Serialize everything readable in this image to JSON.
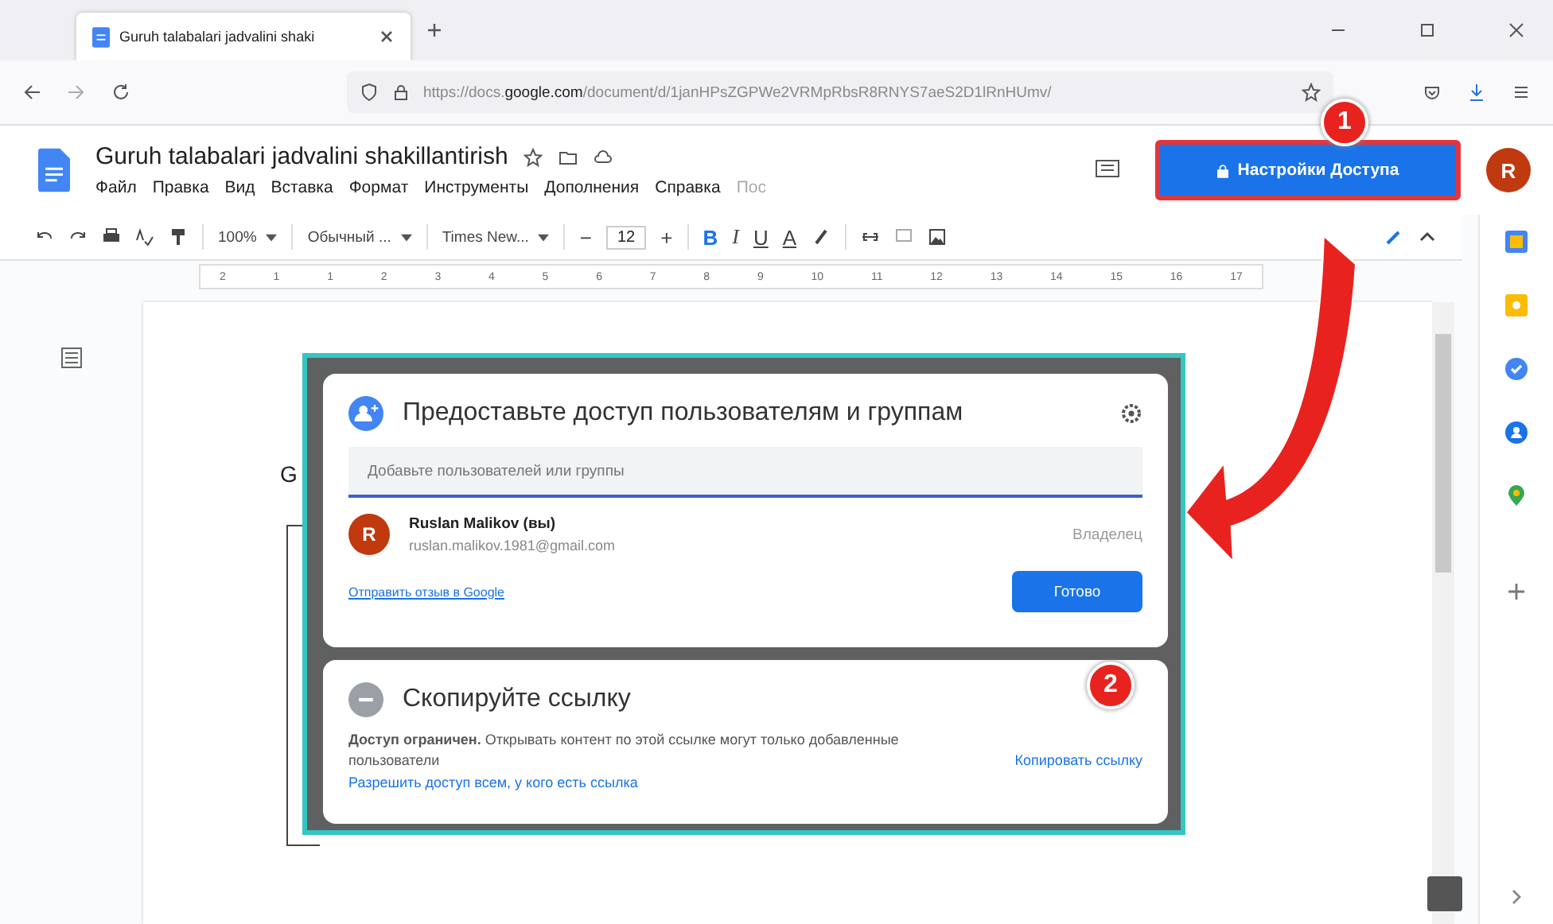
{
  "browser": {
    "tab_title": "Guruh talabalari jadvalini shaki",
    "url_start": "https://docs.",
    "url_domain": "google.com",
    "url_rest": "/document/d/1janHPsZGPWe2VRMpRbsR8RNYS7aeS2D1lRnHUmv/"
  },
  "doc": {
    "title": "Guruh talabalari jadvalini shakillantirish",
    "menu": [
      "Файл",
      "Правка",
      "Вид",
      "Вставка",
      "Формат",
      "Инструменты",
      "Дополнения",
      "Справка"
    ],
    "last_edit": "Пос",
    "share_button": "Настройки Доступа",
    "avatar": "R"
  },
  "toolbar": {
    "zoom": "100%",
    "style": "Обычный ...",
    "font": "Times New...",
    "minus": "−",
    "size": "12",
    "plus": "+",
    "bold": "B",
    "italic": "I",
    "underline": "U",
    "text_color": "A"
  },
  "ruler": [
    "2",
    "1",
    "1",
    "2",
    "3",
    "4",
    "5",
    "6",
    "7",
    "8",
    "9",
    "10",
    "11",
    "12",
    "13",
    "14",
    "15",
    "16",
    "17"
  ],
  "page": {
    "fragment": "G"
  },
  "share_dialog": {
    "title": "Предоставьте доступ пользователям и группам",
    "input_placeholder": "Добавьте пользователей или группы",
    "user": {
      "avatar": "R",
      "name": "Ruslan Malikov (вы)",
      "email": "ruslan.malikov.1981@gmail.com",
      "role": "Владелец"
    },
    "feedback_link": "Отправить отзыв в Google",
    "done_button": "Готово"
  },
  "link_dialog": {
    "title": "Скопируйте ссылку",
    "description": "**Доступ ограничен.** Открывать контент по этой ссылке могут только добавленные пользователи",
    "change_link": "Разрешить доступ всем, у кого есть ссылка",
    "copy_link": "Копировать ссылку"
  },
  "annotations": [
    {
      "label": "1"
    },
    {
      "label": "2"
    }
  ]
}
